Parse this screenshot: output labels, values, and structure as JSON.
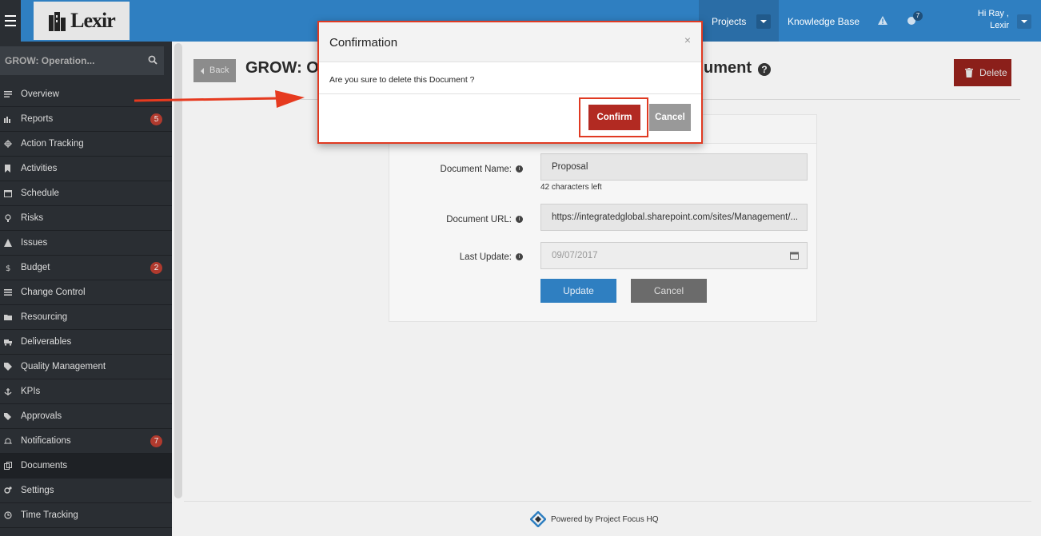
{
  "topbar": {
    "logo_text": "Lexir",
    "nav_projects": "Projects",
    "nav_knowledge_base": "Knowledge Base",
    "notification_count": "7",
    "user_greeting_line1": "Hi Ray ,",
    "user_greeting_line2": "Lexir"
  },
  "sidebar": {
    "project_name": "GROW: Operation...",
    "items": [
      {
        "label": "Overview",
        "icon": "list-icon"
      },
      {
        "label": "Reports",
        "icon": "bar-chart-icon",
        "count": "5"
      },
      {
        "label": "Action Tracking",
        "icon": "crosshair-icon"
      },
      {
        "label": "Activities",
        "icon": "bookmark-icon"
      },
      {
        "label": "Schedule",
        "icon": "calendar-icon"
      },
      {
        "label": "Risks",
        "icon": "lightbulb-icon"
      },
      {
        "label": "Issues",
        "icon": "warning-icon"
      },
      {
        "label": "Budget",
        "icon": "dollar-icon",
        "count": "2"
      },
      {
        "label": "Change Control",
        "icon": "list-icon"
      },
      {
        "label": "Resourcing",
        "icon": "folder-icon"
      },
      {
        "label": "Deliverables",
        "icon": "truck-icon"
      },
      {
        "label": "Quality Management",
        "icon": "tag-icon"
      },
      {
        "label": "KPIs",
        "icon": "anchor-icon"
      },
      {
        "label": "Approvals",
        "icon": "tags-icon"
      },
      {
        "label": "Notifications",
        "icon": "bell-icon",
        "count": "7"
      },
      {
        "label": "Documents",
        "icon": "copy-icon"
      },
      {
        "label": "Settings",
        "icon": "cogs-icon"
      },
      {
        "label": "Time Tracking",
        "icon": "clock-icon"
      }
    ]
  },
  "main": {
    "back_label": "Back",
    "title_start": "GROW: O",
    "title_end": "ument",
    "delete_label": "Delete",
    "form": {
      "document_name_label": "Document Name:",
      "document_name_value": "Proposal",
      "chars_left": "42 characters left",
      "document_url_label": "Document URL:",
      "document_url_value": "https://integratedglobal.sharepoint.com/sites/Management/...",
      "last_update_label": "Last Update:",
      "last_update_value": "09/07/2017",
      "update_label": "Update",
      "cancel_label": "Cancel"
    },
    "footer_text": "Powered by Project Focus HQ"
  },
  "modal": {
    "title": "Confirmation",
    "close_symbol": "×",
    "message": "Are you sure to delete this Document ?",
    "confirm_label": "Confirm",
    "cancel_label": "Cancel"
  },
  "colors": {
    "topbar": "#2f7fc1",
    "sidebar": "#2a2e33",
    "danger": "#b22a22",
    "highlight": "#e03a22"
  }
}
